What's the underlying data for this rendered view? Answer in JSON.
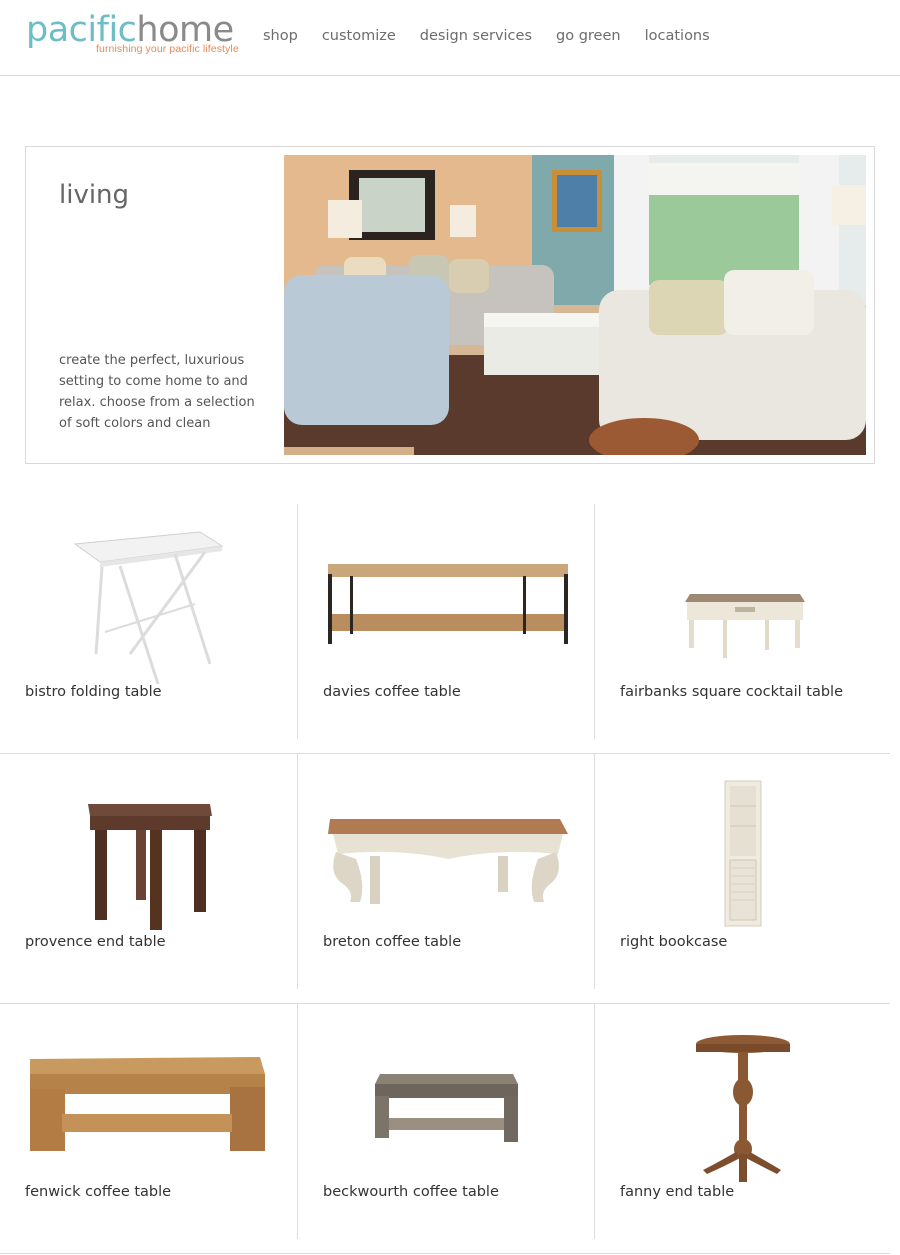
{
  "header": {
    "logo": {
      "part1": "pacific",
      "part2": "home",
      "tagline": "furnishing your pacific lifestyle"
    },
    "nav": [
      "shop",
      "customize",
      "design services",
      "go green",
      "locations"
    ]
  },
  "hero": {
    "title": "living",
    "description": "create the perfect, luxurious setting to come home to and relax. choose from a selection of soft colors and clean"
  },
  "products": [
    {
      "name": "bistro folding table",
      "image": "white-folding-table"
    },
    {
      "name": "davies coffee table",
      "image": "wood-metal-coffee-table"
    },
    {
      "name": "fairbanks square cocktail table",
      "image": "white-cocktail-table"
    },
    {
      "name": "provence end table",
      "image": "dark-wood-end-table"
    },
    {
      "name": "breton coffee table",
      "image": "carved-coffee-table"
    },
    {
      "name": "right bookcase",
      "image": "white-bookcase"
    },
    {
      "name": "fenwick coffee table",
      "image": "rustic-coffee-table"
    },
    {
      "name": "beckwourth coffee table",
      "image": "reclaimed-coffee-table"
    },
    {
      "name": "fanny end table",
      "image": "pedestal-end-table"
    }
  ],
  "colors": {
    "logo_teal": "#6cbdc6",
    "logo_grey": "#8a8a8a",
    "tagline_orange": "#e38a57",
    "divider": "#dcdcdc"
  }
}
